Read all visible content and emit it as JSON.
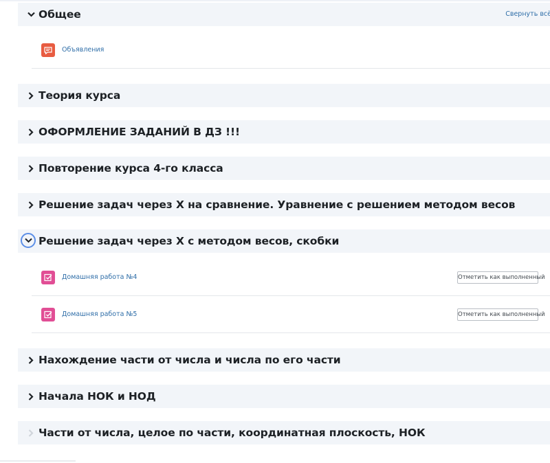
{
  "course_index": {
    "collapse_all_label": "Свернуть всё",
    "sections": [
      {
        "title": "Общее",
        "expanded": true,
        "activities": [
          {
            "icon": "forum-icon",
            "name": "Объявления",
            "completion_button": ""
          }
        ]
      },
      {
        "title": "Теория курса",
        "expanded": false
      },
      {
        "title": "ОФОРМЛЕНИЕ ЗАДАНИЙ В ДЗ !!!",
        "expanded": false
      },
      {
        "title": "Повторение курса 4-го класса",
        "expanded": false
      },
      {
        "title": "Решение задач через Х на сравнение. Уравнение с решением методом весов",
        "expanded": false
      },
      {
        "title": "Решение задач через Х с методом весов, скобки",
        "expanded": true,
        "activities": [
          {
            "icon": "assignment-icon",
            "name": "Домашняя работа №4",
            "completion_button": "Отметить как выполненный"
          },
          {
            "icon": "assignment-icon",
            "name": "Домашняя работа №5",
            "completion_button": "Отметить как выполненный"
          }
        ]
      },
      {
        "title": "Нахождение части от числа и числа по его части",
        "expanded": false
      },
      {
        "title": "Начала НОК и НОД",
        "expanded": false
      },
      {
        "title": "Части от числа, целое по части, координатная плоскость, НОК",
        "expanded": false
      }
    ]
  },
  "colors": {
    "section_header_bg": "#f2f5f9",
    "link": "#2f6ea8",
    "forum_icon": "#e85c41",
    "assignment_icon": "#e14e95",
    "focus_ring": "#5b8ee6"
  }
}
